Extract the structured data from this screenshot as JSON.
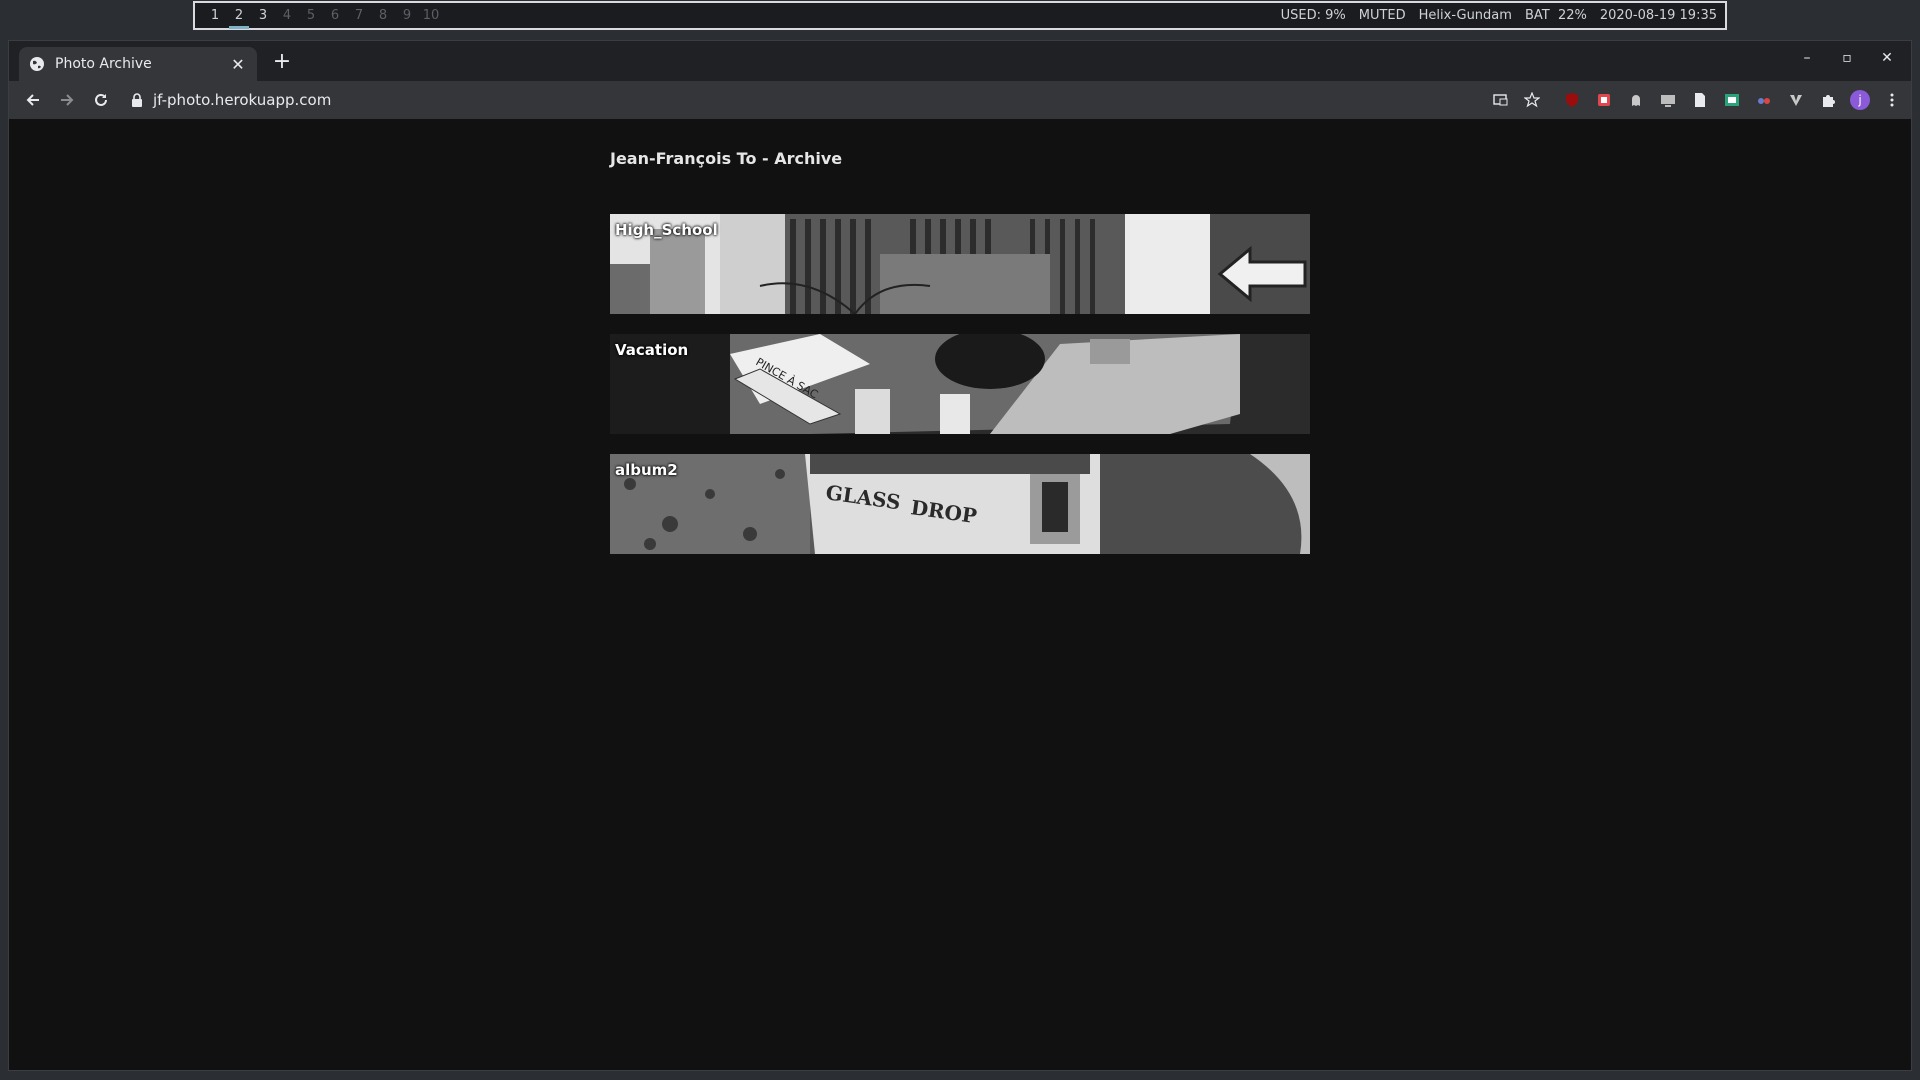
{
  "statusbar": {
    "workspaces": [
      "1",
      "2",
      "3",
      "4",
      "5",
      "6",
      "7",
      "8",
      "9",
      "10"
    ],
    "active_workspace": "2",
    "used": "USED: 9%",
    "muted": "MUTED",
    "host": "Helix-Gundam",
    "battery": "BAT  22%",
    "datetime": "2020-08-19 19:35"
  },
  "browser": {
    "tab_title": "Photo Archive",
    "url": "jf-photo.herokuapp.com",
    "avatar_letter": "j"
  },
  "page": {
    "title": "Jean-François To - Archive",
    "albums": [
      {
        "label": "High_School"
      },
      {
        "label": "Vacation"
      },
      {
        "label": "album2"
      }
    ]
  }
}
